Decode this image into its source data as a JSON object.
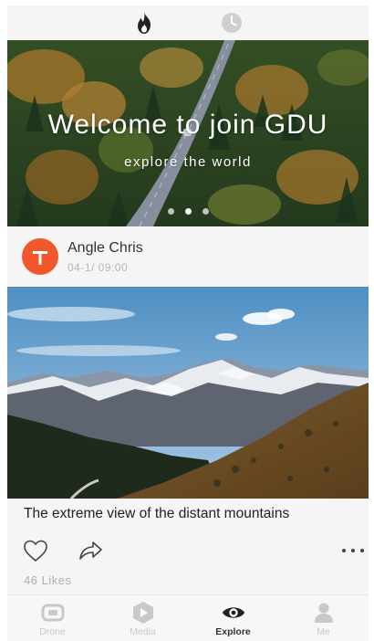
{
  "top_tabs": [
    {
      "icon": "flame-icon",
      "active": true
    },
    {
      "icon": "clock-icon",
      "active": false
    }
  ],
  "banner": {
    "title": "Welcome to join GDU",
    "subtitle": "explore the world",
    "slide_count": 3,
    "active_slide": 2
  },
  "post": {
    "author": "Angle Chris",
    "avatar_letter": "T",
    "time": "04-1/ 09:00",
    "caption": "The extreme view of the distant mountains",
    "likes": "46 Likes"
  },
  "bottom_nav": [
    {
      "label": "Drone",
      "icon": "drone-icon",
      "active": false
    },
    {
      "label": "Media",
      "icon": "media-icon",
      "active": false
    },
    {
      "label": "Explore",
      "icon": "eye-icon",
      "active": true
    },
    {
      "label": "Me",
      "icon": "person-icon",
      "active": false
    }
  ],
  "colors": {
    "accent": "#f1572a",
    "active_nav": "#333333",
    "inactive_nav": "#c8c8c8",
    "background": "#f5f5f5"
  }
}
